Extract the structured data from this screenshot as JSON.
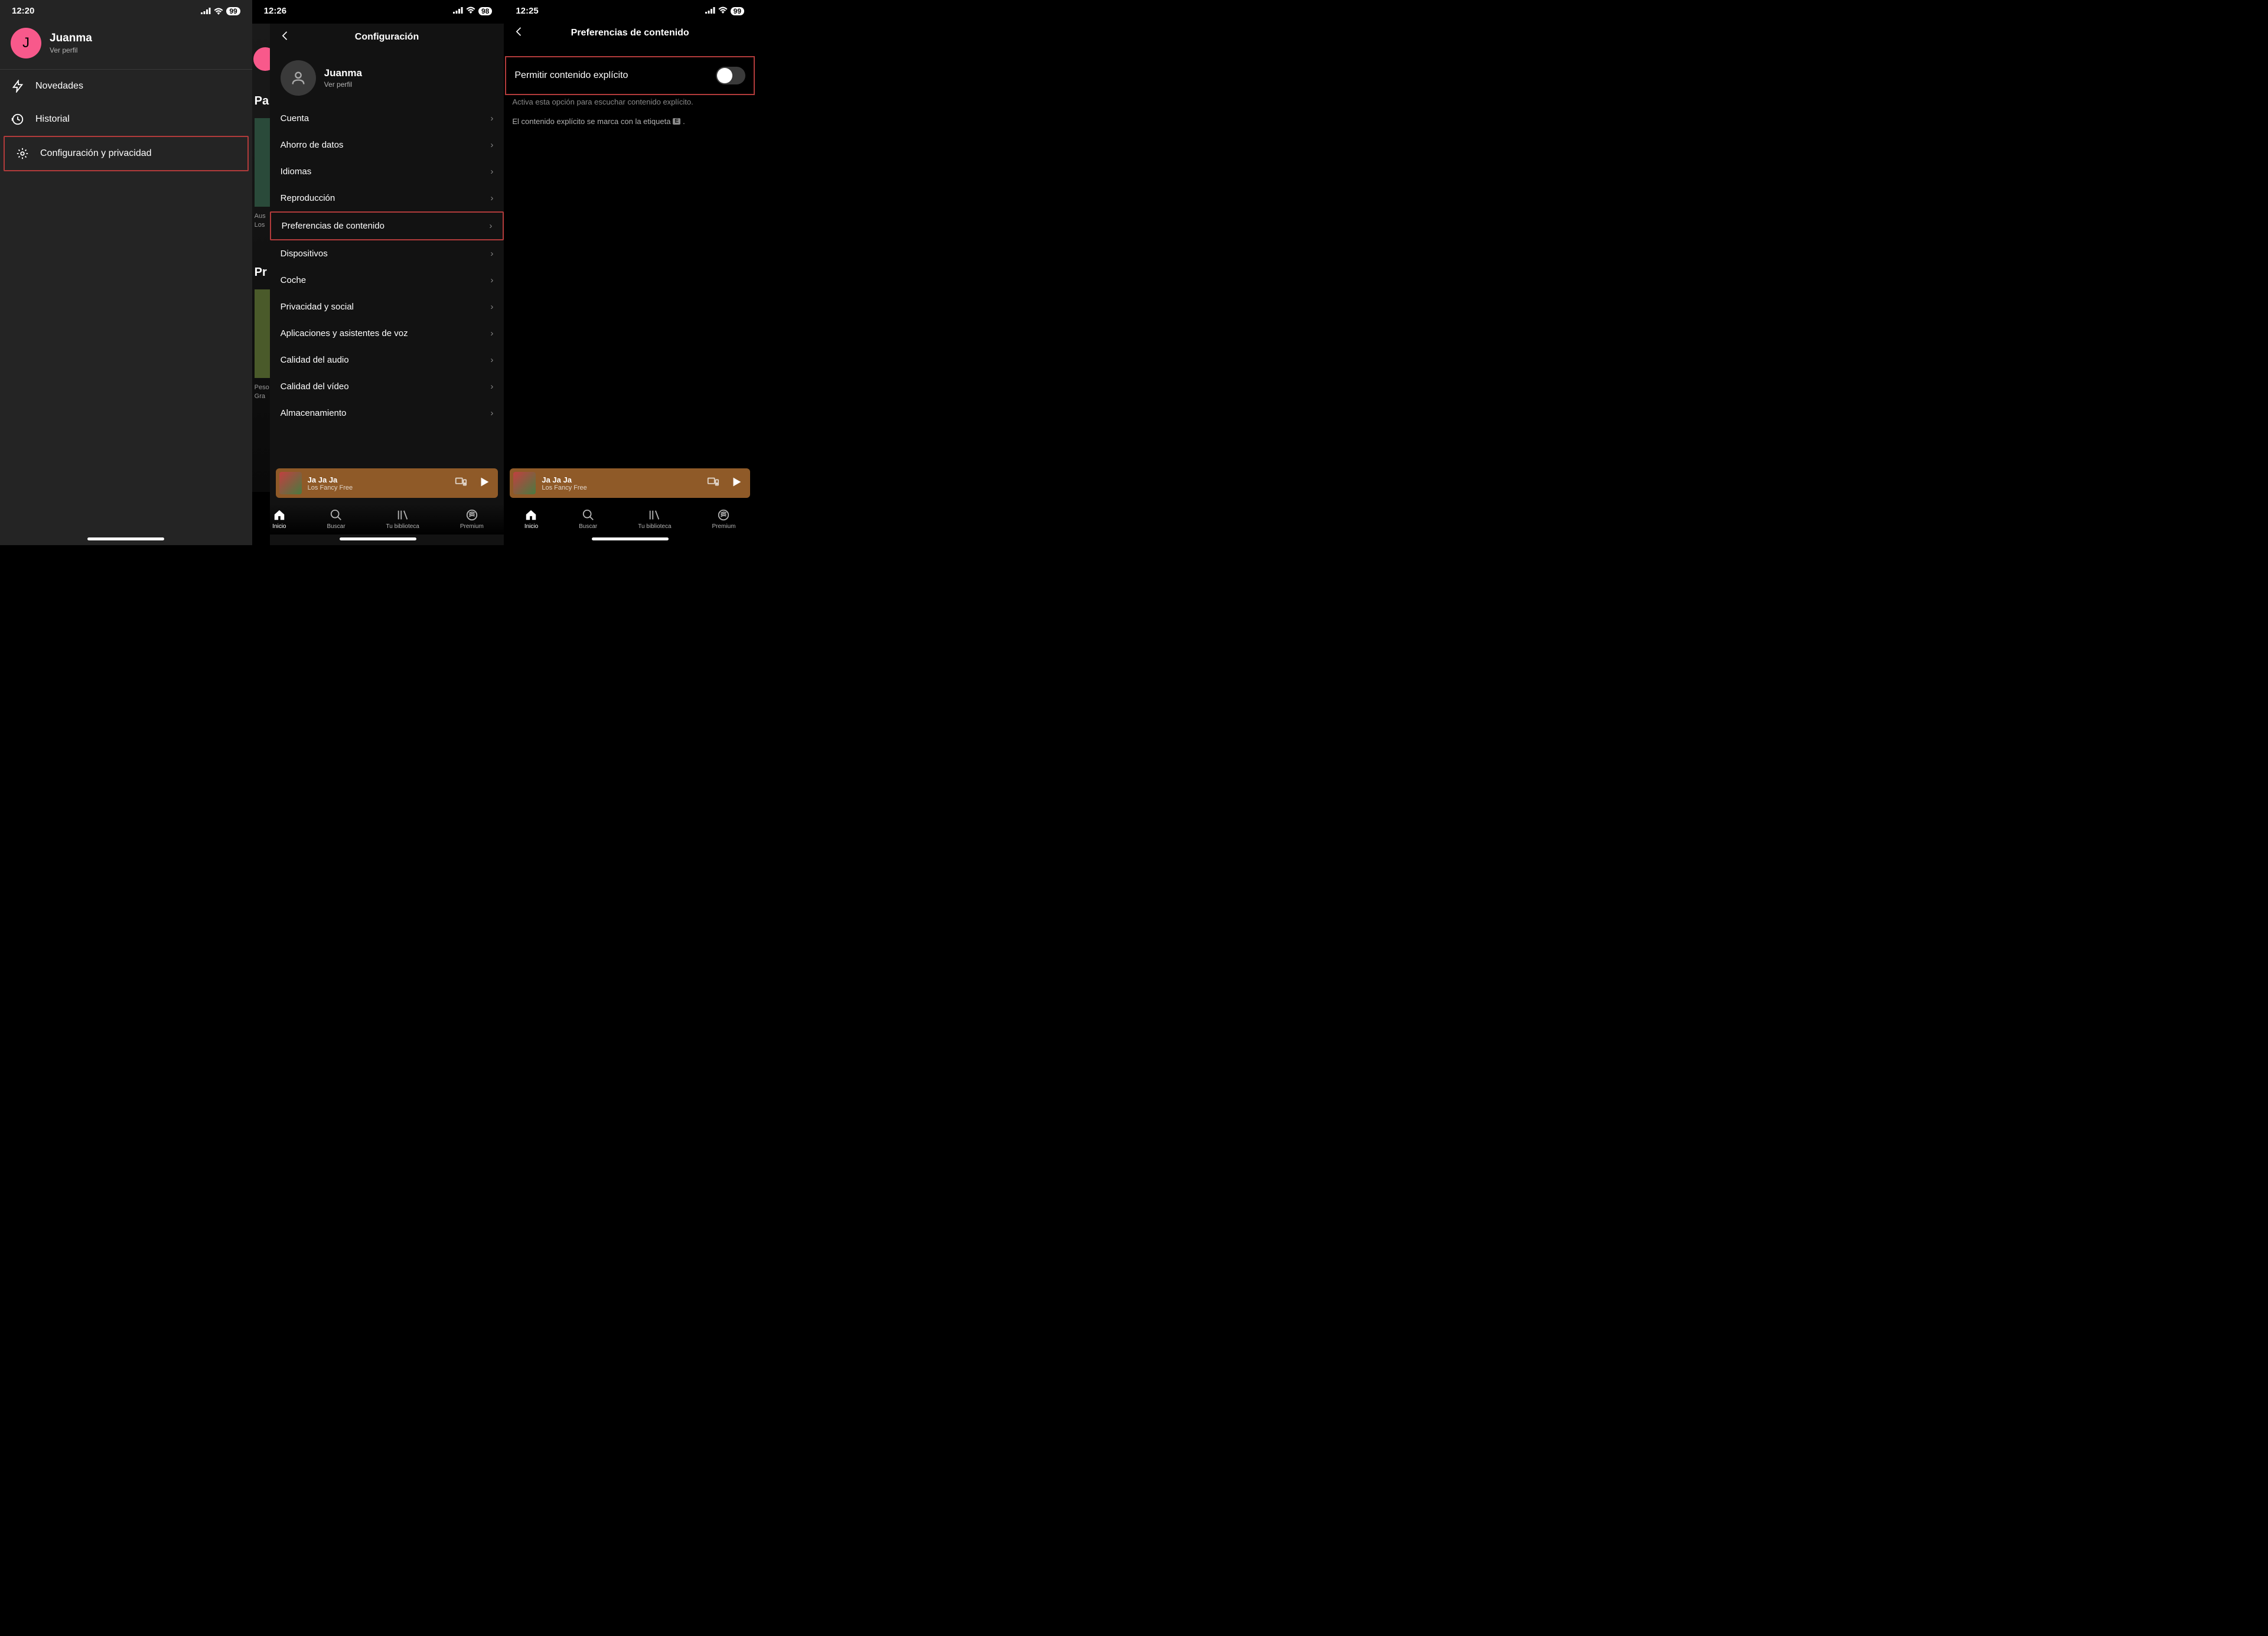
{
  "screen1": {
    "time": "12:20",
    "battery": "99",
    "profile_name": "Juanma",
    "profile_sub": "Ver perfil",
    "avatar_letter": "J",
    "menu": [
      {
        "label": "Novedades"
      },
      {
        "label": "Historial"
      },
      {
        "label": "Configuración y privacidad"
      }
    ]
  },
  "screen2": {
    "time": "12:26",
    "battery": "98",
    "title": "Configuración",
    "profile_name": "Juanma",
    "profile_sub": "Ver perfil",
    "bg": {
      "pa": "Pa",
      "pr": "Pr",
      "aus": "Aus",
      "los": "Los",
      "peso": "Peso",
      "gra": "Gra"
    },
    "items": [
      "Cuenta",
      "Ahorro de datos",
      "Idiomas",
      "Reproducción",
      "Preferencias de contenido",
      "Dispositivos",
      "Coche",
      "Privacidad y social",
      "Aplicaciones y asistentes de voz",
      "Calidad del audio",
      "Calidad del vídeo",
      "Almacenamiento"
    ],
    "player": {
      "title": "Ja Ja Ja",
      "artist": "Los Fancy Free"
    },
    "nav": {
      "inicio": "Inicio",
      "buscar": "Buscar",
      "biblioteca": "Tu biblioteca",
      "premium": "Premium"
    }
  },
  "screen3": {
    "time": "12:25",
    "battery": "99",
    "title": "Preferencias de contenido",
    "toggle_label": "Permitir contenido explícito",
    "help1": "Activa esta opción para escuchar contenido explícito.",
    "help2_pre": "El contenido explícito se marca con la etiqueta",
    "help2_post": ".",
    "etiqueta": "E",
    "player": {
      "title": "Ja Ja Ja",
      "artist": "Los Fancy Free"
    },
    "nav": {
      "inicio": "Inicio",
      "buscar": "Buscar",
      "biblioteca": "Tu biblioteca",
      "premium": "Premium"
    }
  }
}
